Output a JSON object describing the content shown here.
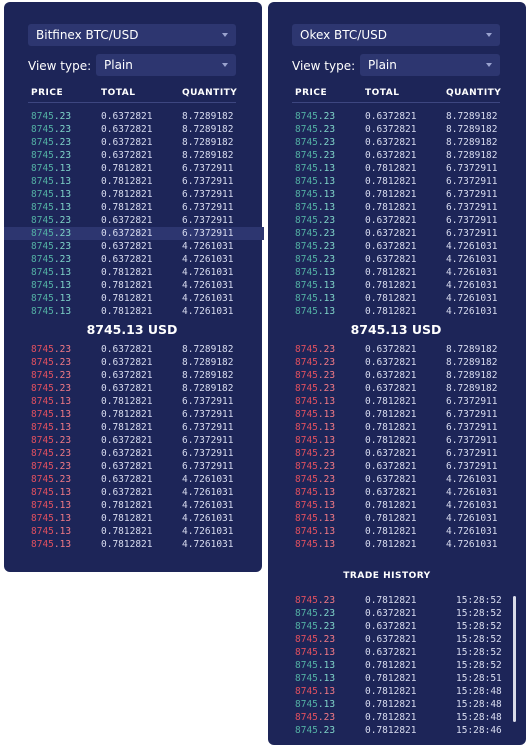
{
  "left": {
    "exchange": "Bitfinex BTC/USD",
    "view_label": "View type:",
    "view_value": "Plain",
    "headers": [
      "PRICE",
      "TOTAL",
      "QUANTITY"
    ],
    "mid_price": "8745.13 USD",
    "highlight_index": 9,
    "bids": [
      [
        "8745.23",
        "0.6372821",
        "8.7289182"
      ],
      [
        "8745.23",
        "0.6372821",
        "8.7289182"
      ],
      [
        "8745.23",
        "0.6372821",
        "8.7289182"
      ],
      [
        "8745.23",
        "0.6372821",
        "8.7289182"
      ],
      [
        "8745.13",
        "0.7812821",
        "6.7372911"
      ],
      [
        "8745.13",
        "0.7812821",
        "6.7372911"
      ],
      [
        "8745.13",
        "0.7812821",
        "6.7372911"
      ],
      [
        "8745.13",
        "0.7812821",
        "6.7372911"
      ],
      [
        "8745.23",
        "0.6372821",
        "6.7372911"
      ],
      [
        "8745.23",
        "0.6372821",
        "6.7372911"
      ],
      [
        "8745.23",
        "0.6372821",
        "4.7261031"
      ],
      [
        "8745.23",
        "0.6372821",
        "4.7261031"
      ],
      [
        "8745.13",
        "0.7812821",
        "4.7261031"
      ],
      [
        "8745.13",
        "0.7812821",
        "4.7261031"
      ],
      [
        "8745.13",
        "0.7812821",
        "4.7261031"
      ],
      [
        "8745.13",
        "0.7812821",
        "4.7261031"
      ]
    ],
    "asks": [
      [
        "8745.23",
        "0.6372821",
        "8.7289182"
      ],
      [
        "8745.23",
        "0.6372821",
        "8.7289182"
      ],
      [
        "8745.23",
        "0.6372821",
        "8.7289182"
      ],
      [
        "8745.23",
        "0.6372821",
        "8.7289182"
      ],
      [
        "8745.13",
        "0.7812821",
        "6.7372911"
      ],
      [
        "8745.13",
        "0.7812821",
        "6.7372911"
      ],
      [
        "8745.13",
        "0.7812821",
        "6.7372911"
      ],
      [
        "8745.23",
        "0.6372821",
        "6.7372911"
      ],
      [
        "8745.23",
        "0.6372821",
        "6.7372911"
      ],
      [
        "8745.23",
        "0.6372821",
        "6.7372911"
      ],
      [
        "8745.23",
        "0.6372821",
        "4.7261031"
      ],
      [
        "8745.13",
        "0.6372821",
        "4.7261031"
      ],
      [
        "8745.13",
        "0.7812821",
        "4.7261031"
      ],
      [
        "8745.13",
        "0.7812821",
        "4.7261031"
      ],
      [
        "8745.13",
        "0.7812821",
        "4.7261031"
      ],
      [
        "8745.13",
        "0.7812821",
        "4.7261031"
      ]
    ]
  },
  "right": {
    "exchange": "Okex BTC/USD",
    "view_label": "View type:",
    "view_value": "Plain",
    "headers": [
      "PRICE",
      "TOTAL",
      "QUANTITY"
    ],
    "mid_price": "8745.13 USD",
    "highlight_index": -1,
    "bids": [
      [
        "8745.23",
        "0.6372821",
        "8.7289182"
      ],
      [
        "8745.23",
        "0.6372821",
        "8.7289182"
      ],
      [
        "8745.23",
        "0.6372821",
        "8.7289182"
      ],
      [
        "8745.23",
        "0.6372821",
        "8.7289182"
      ],
      [
        "8745.13",
        "0.7812821",
        "6.7372911"
      ],
      [
        "8745.13",
        "0.7812821",
        "6.7372911"
      ],
      [
        "8745.13",
        "0.7812821",
        "6.7372911"
      ],
      [
        "8745.13",
        "0.7812821",
        "6.7372911"
      ],
      [
        "8745.23",
        "0.6372821",
        "6.7372911"
      ],
      [
        "8745.23",
        "0.6372821",
        "6.7372911"
      ],
      [
        "8745.23",
        "0.6372821",
        "4.7261031"
      ],
      [
        "8745.23",
        "0.6372821",
        "4.7261031"
      ],
      [
        "8745.13",
        "0.7812821",
        "4.7261031"
      ],
      [
        "8745.13",
        "0.7812821",
        "4.7261031"
      ],
      [
        "8745.13",
        "0.7812821",
        "4.7261031"
      ],
      [
        "8745.13",
        "0.7812821",
        "4.7261031"
      ]
    ],
    "asks": [
      [
        "8745.23",
        "0.6372821",
        "8.7289182"
      ],
      [
        "8745.23",
        "0.6372821",
        "8.7289182"
      ],
      [
        "8745.23",
        "0.6372821",
        "8.7289182"
      ],
      [
        "8745.23",
        "0.6372821",
        "8.7289182"
      ],
      [
        "8745.13",
        "0.7812821",
        "6.7372911"
      ],
      [
        "8745.13",
        "0.7812821",
        "6.7372911"
      ],
      [
        "8745.13",
        "0.7812821",
        "6.7372911"
      ],
      [
        "8745.13",
        "0.7812821",
        "6.7372911"
      ],
      [
        "8745.23",
        "0.6372821",
        "6.7372911"
      ],
      [
        "8745.23",
        "0.6372821",
        "6.7372911"
      ],
      [
        "8745.23",
        "0.6372821",
        "4.7261031"
      ],
      [
        "8745.13",
        "0.6372821",
        "4.7261031"
      ],
      [
        "8745.13",
        "0.7812821",
        "4.7261031"
      ],
      [
        "8745.13",
        "0.7812821",
        "4.7261031"
      ],
      [
        "8745.13",
        "0.7812821",
        "4.7261031"
      ],
      [
        "8745.13",
        "0.7812821",
        "4.7261031"
      ]
    ]
  },
  "trade_history": {
    "title": "TRADE HISTORY",
    "rows": [
      [
        "8745.23",
        "0.7812821",
        "15:28:52",
        "sell"
      ],
      [
        "8745.23",
        "0.6372821",
        "15:28:52",
        "buy"
      ],
      [
        "8745.23",
        "0.6372821",
        "15:28:52",
        "buy"
      ],
      [
        "8745.23",
        "0.6372821",
        "15:28:52",
        "sell"
      ],
      [
        "8745.13",
        "0.6372821",
        "15:28:52",
        "sell"
      ],
      [
        "8745.13",
        "0.7812821",
        "15:28:52",
        "buy"
      ],
      [
        "8745.13",
        "0.7812821",
        "15:28:51",
        "buy"
      ],
      [
        "8745.13",
        "0.7812821",
        "15:28:48",
        "sell"
      ],
      [
        "8745.13",
        "0.7812821",
        "15:28:48",
        "buy"
      ],
      [
        "8745.23",
        "0.7812821",
        "15:28:48",
        "sell"
      ],
      [
        "8745.23",
        "0.7812821",
        "15:28:46",
        "buy"
      ]
    ]
  },
  "colors": {
    "panel_bg": "#1d2558",
    "buy": "#53b0a4",
    "sell": "#e0505f"
  }
}
